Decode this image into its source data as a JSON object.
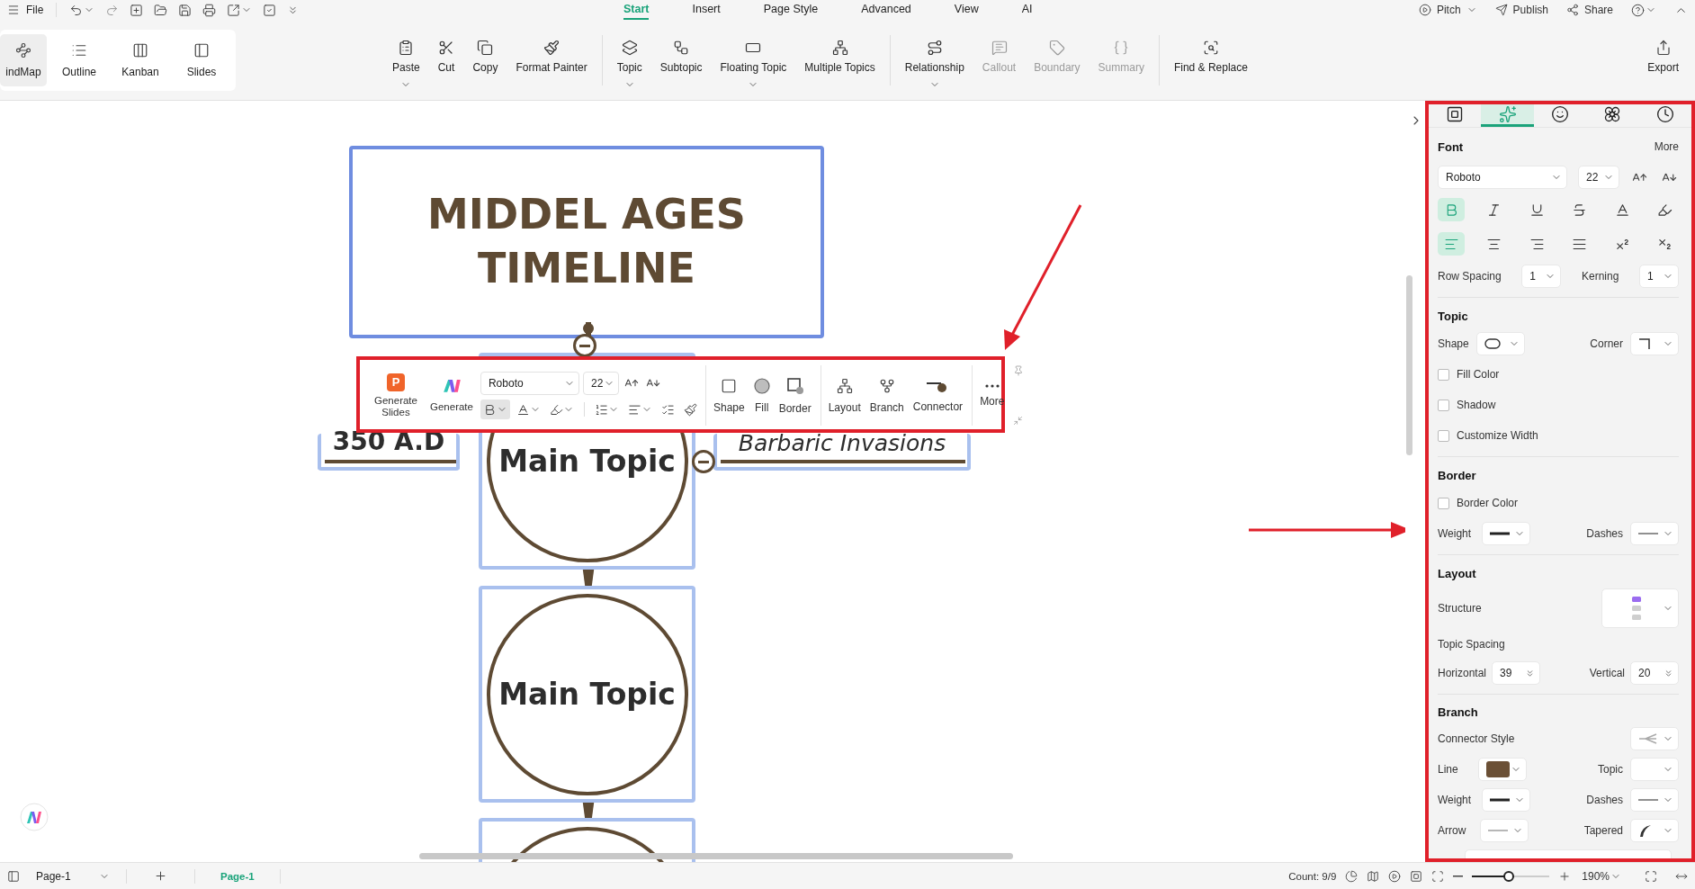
{
  "menu_bar": {
    "file": "File",
    "tabs": [
      {
        "label": "Start",
        "selected": true
      },
      {
        "label": "Insert",
        "selected": false
      },
      {
        "label": "Page Style",
        "selected": false
      },
      {
        "label": "Advanced",
        "selected": false
      },
      {
        "label": "View",
        "selected": false
      },
      {
        "label": "AI",
        "selected": false
      }
    ],
    "actions": [
      {
        "label": "Pitch"
      },
      {
        "label": "Publish"
      },
      {
        "label": "Share"
      }
    ]
  },
  "view_switcher": [
    {
      "label": "indMap",
      "selected": true
    },
    {
      "label": "Outline",
      "selected": false
    },
    {
      "label": "Kanban",
      "selected": false
    },
    {
      "label": "Slides",
      "selected": false
    }
  ],
  "ribbon": [
    [
      {
        "label": "Paste",
        "caret": true,
        "disabled": false
      },
      {
        "label": "Cut",
        "caret": false,
        "disabled": false
      },
      {
        "label": "Copy",
        "caret": false,
        "disabled": false
      },
      {
        "label": "Format Painter",
        "caret": false,
        "disabled": false
      }
    ],
    [
      {
        "label": "Topic",
        "caret": true,
        "disabled": false
      },
      {
        "label": "Subtopic",
        "caret": false,
        "disabled": false
      },
      {
        "label": "Floating Topic",
        "caret": true,
        "disabled": false
      },
      {
        "label": "Multiple Topics",
        "caret": false,
        "disabled": false
      }
    ],
    [
      {
        "label": "Relationship",
        "caret": true,
        "disabled": false
      },
      {
        "label": "Callout",
        "caret": false,
        "disabled": true
      },
      {
        "label": "Boundary",
        "caret": false,
        "disabled": true
      },
      {
        "label": "Summary",
        "caret": false,
        "disabled": true
      }
    ],
    [
      {
        "label": "Find & Replace",
        "caret": false,
        "disabled": false
      }
    ]
  ],
  "export": "Export",
  "canvas": {
    "title": "MIDDEL AGES TIMELINE",
    "left_topic": "350 A.D",
    "right_topic": "Barbaric Invasions",
    "main_topics": [
      "Main Topic",
      "Main Topic"
    ]
  },
  "floating_toolbar": {
    "generate_slides": {
      "badge": "P",
      "label": "Generate Slides"
    },
    "generate": "Generate",
    "font": "Roboto",
    "size": "22",
    "format": [
      {
        "selected": true,
        "caret": true
      },
      {
        "selected": false,
        "caret": true
      },
      {
        "selected": false,
        "caret": true
      },
      {
        "selected": false,
        "caret": true
      },
      {
        "selected": false,
        "caret": true
      },
      {
        "selected": false,
        "caret": false
      },
      {
        "selected": false,
        "caret": false
      }
    ],
    "tools": [
      [
        "Shape",
        "Fill",
        "Border"
      ],
      [
        "Layout",
        "Branch",
        "Connector"
      ],
      [
        "More"
      ]
    ]
  },
  "panel": {
    "tabs": [
      {
        "selected": false
      },
      {
        "selected": true
      },
      {
        "selected": false
      },
      {
        "selected": false
      },
      {
        "selected": false
      }
    ],
    "font": {
      "heading": "Font",
      "more": "More",
      "family": "Roboto",
      "size": "22",
      "styles": [
        {
          "selected": true
        },
        {
          "selected": false
        },
        {
          "selected": false
        },
        {
          "selected": false
        },
        {
          "selected": false
        },
        {
          "selected": false
        }
      ],
      "aligns": [
        {
          "selected": true
        },
        {
          "selected": false
        },
        {
          "selected": false
        },
        {
          "selected": false
        },
        {
          "selected": false
        },
        {
          "selected": false
        }
      ],
      "row_spacing": {
        "label": "Row Spacing",
        "value": "1"
      },
      "kerning": {
        "label": "Kerning",
        "value": "1"
      }
    },
    "topic": {
      "heading": "Topic",
      "shape_label": "Shape",
      "corner_label": "Corner",
      "options": [
        {
          "label": "Fill Color",
          "checked": false
        },
        {
          "label": "Shadow",
          "checked": false
        },
        {
          "label": "Customize Width",
          "checked": false
        }
      ]
    },
    "border": {
      "heading": "Border",
      "options": [
        {
          "label": "Border Color",
          "checked": false
        }
      ],
      "weight_label": "Weight",
      "dashes_label": "Dashes"
    },
    "layout": {
      "heading": "Layout",
      "structure_label": "Structure",
      "spacing_label": "Topic Spacing",
      "horizontal": {
        "label": "Horizontal",
        "value": "39"
      },
      "vertical": {
        "label": "Vertical",
        "value": "20"
      }
    },
    "branch": {
      "heading": "Branch",
      "connector_label": "Connector Style",
      "line_label": "Line",
      "topic_label": "Topic",
      "weight_label": "Weight",
      "dashes_label": "Dashes",
      "arrow_label": "Arrow",
      "tapered_label": "Tapered"
    }
  },
  "status_bar": {
    "page_select": "Page-1",
    "page_tab": "Page-1",
    "count": "Count: 9/9",
    "zoom": {
      "level": 0.47,
      "reading": "190%"
    }
  }
}
